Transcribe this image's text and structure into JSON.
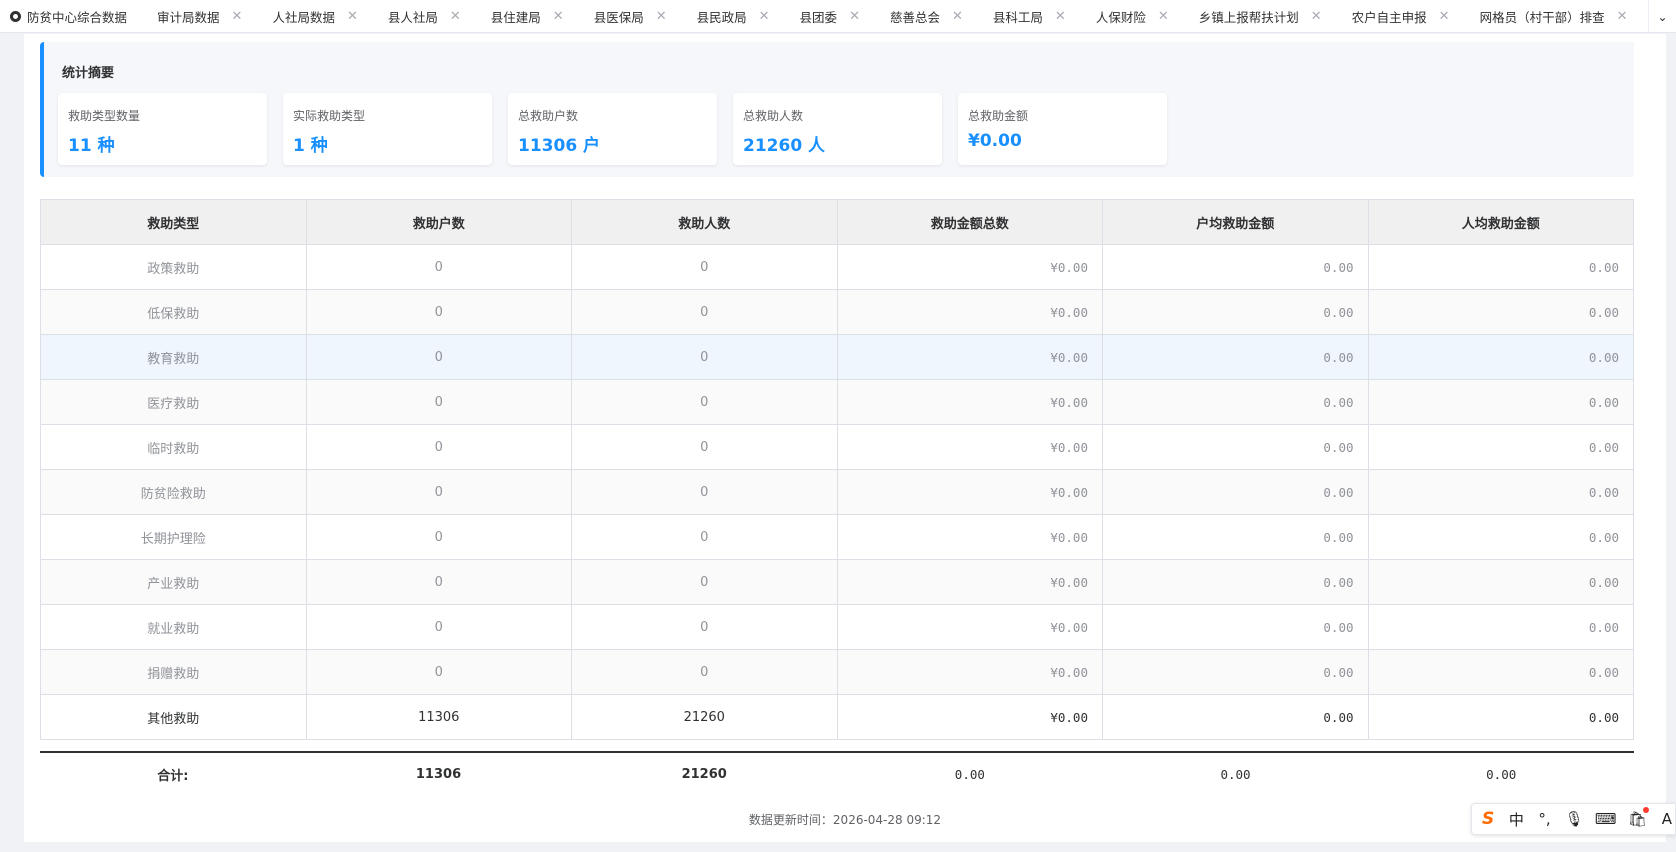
{
  "tabs": [
    {
      "label": "防贫中心综合数据",
      "icon": "eye-icon",
      "closable": false
    },
    {
      "label": "审计局数据",
      "closable": true
    },
    {
      "label": "人社局数据",
      "closable": true
    },
    {
      "label": "县人社局",
      "closable": true
    },
    {
      "label": "县住建局",
      "closable": true
    },
    {
      "label": "县医保局",
      "closable": true
    },
    {
      "label": "县民政局",
      "closable": true
    },
    {
      "label": "县团委",
      "closable": true
    },
    {
      "label": "慈善总会",
      "closable": true
    },
    {
      "label": "县科工局",
      "closable": true
    },
    {
      "label": "人保财险",
      "closable": true
    },
    {
      "label": "乡镇上报帮扶计划",
      "closable": true
    },
    {
      "label": "农户自主申报",
      "closable": true
    },
    {
      "label": "网格员（村干部）排查",
      "closable": true
    }
  ],
  "tab_close_glyph": "✕",
  "tab_scroll_glyph": "⌄",
  "summary": {
    "title": "统计摘要",
    "cards": [
      {
        "label": "救助类型数量",
        "value": "11 种"
      },
      {
        "label": "实际救助类型",
        "value": "1 种"
      },
      {
        "label": "总救助户数",
        "value": "11306 户"
      },
      {
        "label": "总救助人数",
        "value": "21260 人"
      },
      {
        "label": "总救助金额",
        "value": "¥0.00"
      }
    ]
  },
  "table": {
    "headers": [
      "救助类型",
      "救助户数",
      "救助人数",
      "救助金额总数",
      "户均救助金额",
      "人均救助金额"
    ],
    "rows": [
      {
        "type": "政策救助",
        "households": "0",
        "people": "0",
        "total": "¥0.00",
        "per_household": "0.00",
        "per_person": "0.00"
      },
      {
        "type": "低保救助",
        "households": "0",
        "people": "0",
        "total": "¥0.00",
        "per_household": "0.00",
        "per_person": "0.00"
      },
      {
        "type": "教育救助",
        "households": "0",
        "people": "0",
        "total": "¥0.00",
        "per_household": "0.00",
        "per_person": "0.00"
      },
      {
        "type": "医疗救助",
        "households": "0",
        "people": "0",
        "total": "¥0.00",
        "per_household": "0.00",
        "per_person": "0.00"
      },
      {
        "type": "临时救助",
        "households": "0",
        "people": "0",
        "total": "¥0.00",
        "per_household": "0.00",
        "per_person": "0.00"
      },
      {
        "type": "防贫险救助",
        "households": "0",
        "people": "0",
        "total": "¥0.00",
        "per_household": "0.00",
        "per_person": "0.00"
      },
      {
        "type": "长期护理险",
        "households": "0",
        "people": "0",
        "total": "¥0.00",
        "per_household": "0.00",
        "per_person": "0.00"
      },
      {
        "type": "产业救助",
        "households": "0",
        "people": "0",
        "total": "¥0.00",
        "per_household": "0.00",
        "per_person": "0.00"
      },
      {
        "type": "就业救助",
        "households": "0",
        "people": "0",
        "total": "¥0.00",
        "per_household": "0.00",
        "per_person": "0.00"
      },
      {
        "type": "捐赠救助",
        "households": "0",
        "people": "0",
        "total": "¥0.00",
        "per_household": "0.00",
        "per_person": "0.00"
      },
      {
        "type": "其他救助",
        "households": "11306",
        "people": "21260",
        "total": "¥0.00",
        "per_household": "0.00",
        "per_person": "0.00"
      }
    ]
  },
  "totals": {
    "label": "合计:",
    "households": "11306",
    "people": "21260",
    "total": "0.00",
    "per_household": "0.00",
    "per_person": "0.00"
  },
  "update_time": "数据更新时间：2026-04-28 09:12",
  "ime": {
    "logo": "S",
    "mode": "中",
    "punct": "°,",
    "mic": "🎙",
    "keyboard": "⌨",
    "gift": "🛍",
    "more": "A"
  },
  "colors": {
    "accent": "#1890ff",
    "header_bg": "#f0f0f0",
    "highlight_row": "#f0f6fe"
  }
}
